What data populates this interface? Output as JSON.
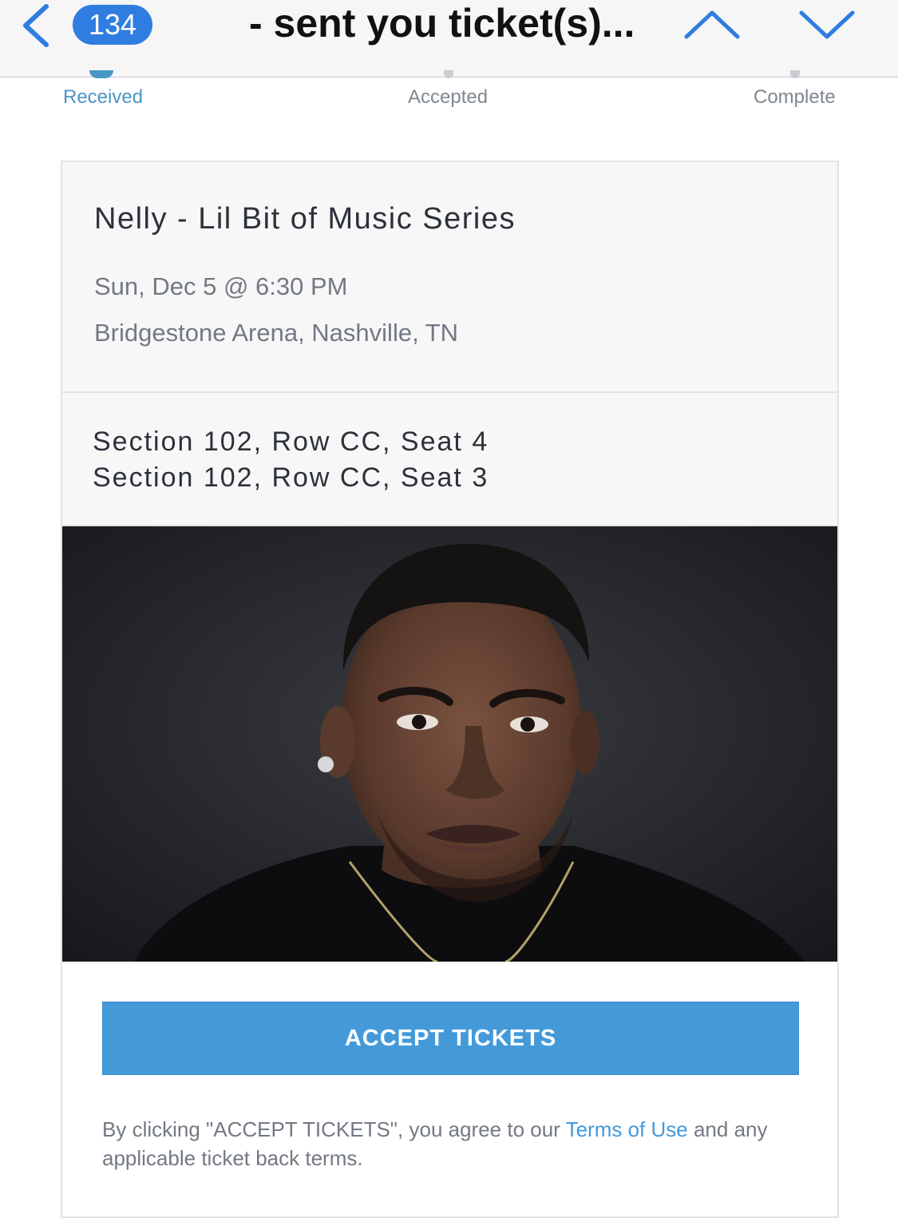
{
  "header": {
    "unread_count": "134",
    "email_subject": "- sent you ticket(s)..."
  },
  "progress": {
    "steps": [
      "Received",
      "Accepted",
      "Complete"
    ],
    "active_step": "Received"
  },
  "event": {
    "name": "Nelly - Lil Bit of Music Series",
    "date": "Sun, Dec 5 @ 6:30 PM",
    "venue": "Bridgestone Arena, Nashville, TN"
  },
  "seats": [
    "Section 102, Row CC, Seat 4",
    "Section 102, Row CC, Seat 3"
  ],
  "actions": {
    "accept_label": "ACCEPT TICKETS"
  },
  "legal": {
    "prefix": "By clicking \"ACCEPT TICKETS\", you agree to our ",
    "link_text": "Terms of Use",
    "suffix": " and any applicable ticket back terms."
  },
  "colors": {
    "ios_accent": "#2f7de1",
    "brand_blue": "#4499d9",
    "text_dark": "#2c313a",
    "text_muted": "#737983"
  }
}
